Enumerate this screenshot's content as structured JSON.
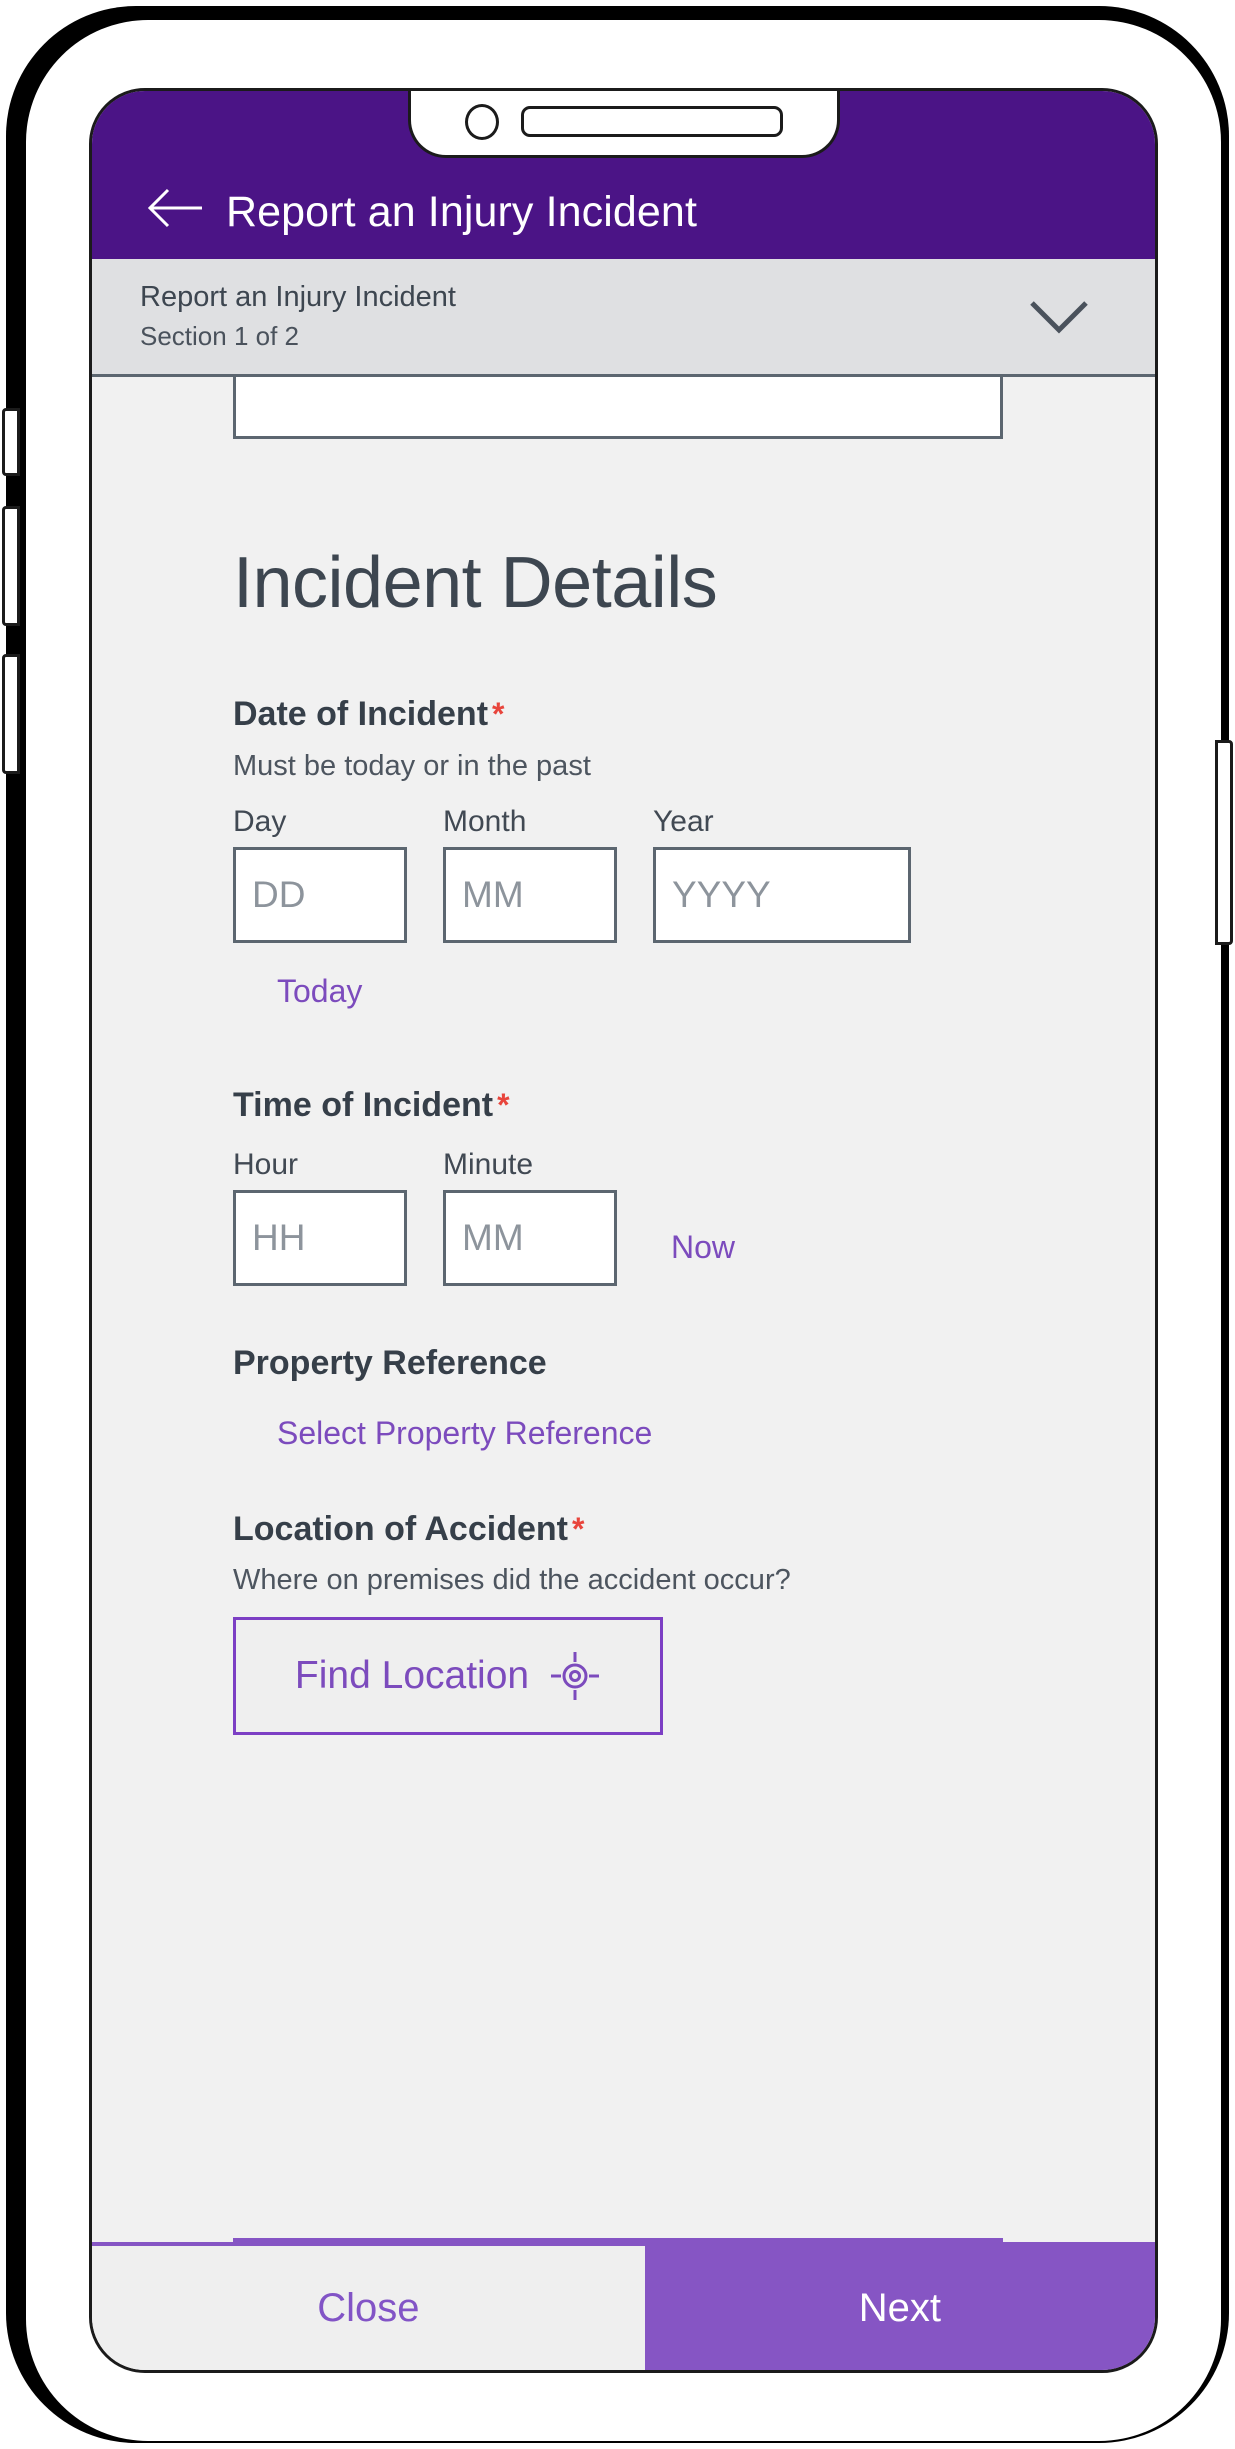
{
  "header": {
    "title": "Report an Injury Incident",
    "back_icon": "arrow-left-icon"
  },
  "section_bar": {
    "title": "Report an Injury Incident",
    "subtitle": "Section 1 of 2",
    "chevron_icon": "chevron-down-icon"
  },
  "page": {
    "heading": "Incident Details"
  },
  "fields": {
    "date_of_incident": {
      "label": "Date of Incident",
      "required_marker": "*",
      "hint": "Must be today or in the past",
      "day": {
        "label": "Day",
        "placeholder": "DD",
        "value": ""
      },
      "month": {
        "label": "Month",
        "placeholder": "MM",
        "value": ""
      },
      "year": {
        "label": "Year",
        "placeholder": "YYYY",
        "value": ""
      },
      "shortcut_link": "Today"
    },
    "time_of_incident": {
      "label": "Time of Incident",
      "required_marker": "*",
      "hour": {
        "label": "Hour",
        "placeholder": "HH",
        "value": ""
      },
      "minute": {
        "label": "Minute",
        "placeholder": "MM",
        "value": ""
      },
      "shortcut_link": "Now"
    },
    "property_reference": {
      "label": "Property Reference",
      "select_link": "Select Property Reference"
    },
    "location_of_accident": {
      "label": "Location of Accident",
      "required_marker": "*",
      "hint": "Where on premises did the accident occur?",
      "button_label": "Find Location",
      "button_icon": "crosshair-target-icon"
    }
  },
  "bottom_bar": {
    "close_label": "Close",
    "next_label": "Next"
  },
  "colors": {
    "header_purple": "#4B1486",
    "accent_purple": "#8655C4",
    "link_purple": "#7C4BBD",
    "required_red": "#E8453C",
    "section_grey": "#DFE0E2",
    "body_grey": "#F1F1F1"
  }
}
